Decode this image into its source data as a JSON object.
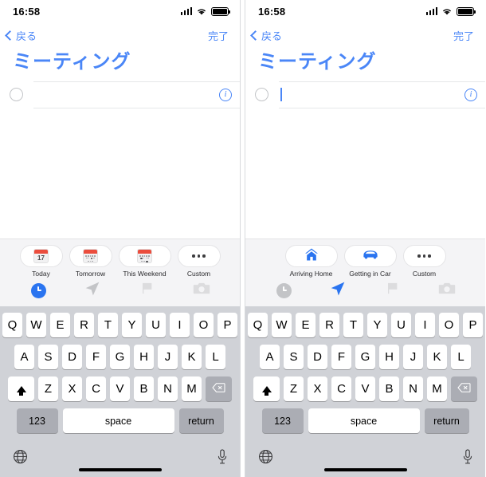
{
  "panels": [
    {
      "id": "left",
      "status": {
        "time": "16:58",
        "signal_icon": "cellular-signal-icon",
        "wifi_icon": "wifi-icon",
        "battery_icon": "battery-full-icon"
      },
      "nav": {
        "back_label": "戻る",
        "done_label": "完了",
        "back_icon": "chevron-left-icon"
      },
      "title": "ミーティング",
      "task": {
        "value": "",
        "placeholder": "",
        "checkbox_icon": "circle-unchecked-icon",
        "info_icon": "info-circle-icon",
        "caret_visible": false
      },
      "suggestions": [
        {
          "label": "Today",
          "icon": "calendar-day-icon",
          "day_number": "17",
          "style": "day"
        },
        {
          "label": "Tomorrow",
          "icon": "calendar-tomorrow-icon",
          "style": "dots-center"
        },
        {
          "label": "This Weekend",
          "icon": "calendar-weekend-icon",
          "style": "dots-grid",
          "wide": true
        },
        {
          "label": "Custom",
          "icon": "ellipsis-icon",
          "style": "ellipsis"
        }
      ],
      "tabs": [
        {
          "name": "tab-time",
          "icon": "clock-icon",
          "active": true
        },
        {
          "name": "tab-location",
          "icon": "navigation-arrow-icon",
          "active": false
        },
        {
          "name": "tab-flag",
          "icon": "flag-icon",
          "active": false
        },
        {
          "name": "tab-camera",
          "icon": "camera-icon",
          "active": false
        }
      ]
    },
    {
      "id": "right",
      "status": {
        "time": "16:58",
        "signal_icon": "cellular-signal-icon",
        "wifi_icon": "wifi-icon",
        "battery_icon": "battery-full-icon"
      },
      "nav": {
        "back_label": "戻る",
        "done_label": "完了",
        "back_icon": "chevron-left-icon"
      },
      "title": "ミーティング",
      "task": {
        "value": "",
        "placeholder": "",
        "checkbox_icon": "circle-unchecked-icon",
        "info_icon": "info-circle-icon",
        "caret_visible": true
      },
      "suggestions": [
        {
          "label": "Arriving Home",
          "icon": "home-icon",
          "style": "home",
          "wide": true
        },
        {
          "label": "Getting in Car",
          "icon": "car-icon",
          "style": "car",
          "wide": true
        },
        {
          "label": "Custom",
          "icon": "ellipsis-icon",
          "style": "ellipsis"
        }
      ],
      "tabs": [
        {
          "name": "tab-time",
          "icon": "clock-icon",
          "active": false
        },
        {
          "name": "tab-location",
          "icon": "navigation-arrow-icon",
          "active": true
        },
        {
          "name": "tab-flag",
          "icon": "flag-icon",
          "active": false
        },
        {
          "name": "tab-camera",
          "icon": "camera-icon",
          "active": false
        }
      ]
    }
  ],
  "keyboard": {
    "row1": [
      "Q",
      "W",
      "E",
      "R",
      "T",
      "Y",
      "U",
      "I",
      "O",
      "P"
    ],
    "row2": [
      "A",
      "S",
      "D",
      "F",
      "G",
      "H",
      "J",
      "K",
      "L"
    ],
    "row3": [
      "Z",
      "X",
      "C",
      "V",
      "B",
      "N",
      "M"
    ],
    "shift_icon": "shift-up-arrow-icon",
    "backspace_icon": "backspace-delete-icon",
    "numbers_label": "123",
    "space_label": "space",
    "return_label": "return",
    "globe_icon": "globe-language-icon",
    "mic_icon": "microphone-icon",
    "home_indicator": "home-indicator-bar"
  },
  "colors": {
    "accent_blue": "#4a86f7",
    "tab_active_blue": "#2a74f0",
    "calendar_red": "#eb4d3d",
    "keyboard_bg": "#d0d2d7",
    "key_dark": "#abadb4",
    "suggest_bg": "#f4f4f6"
  }
}
